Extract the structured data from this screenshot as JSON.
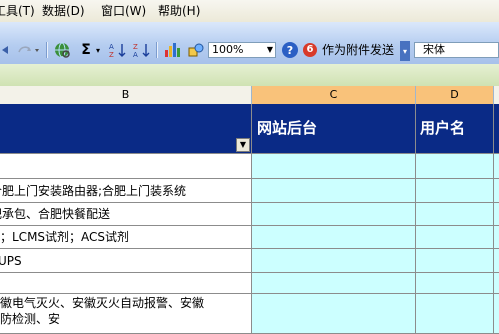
{
  "menu": {
    "tools": "工具(T)",
    "data": "数据(D)",
    "window": "窗口(W)",
    "help": "帮助(H)"
  },
  "toolbar": {
    "zoom": "100%",
    "send_label": "作为附件发送",
    "font_name": "宋体",
    "sigma": "Σ",
    "help_glyph": "?",
    "send_glyph": "6"
  },
  "columns": [
    {
      "label": "B"
    },
    {
      "label": "C"
    },
    {
      "label": "D"
    }
  ],
  "header_row": {
    "col_c": "网站后台",
    "col_d": "用户名"
  },
  "rows": [
    {
      "b": ""
    },
    {
      "b": "合肥上门安装路由器;合肥上门装系统"
    },
    {
      "b": "合肥承包、合肥快餐配送"
    },
    {
      "b": "试剂；LCMS试剂；ACS试剂"
    },
    {
      "b": "UPS"
    },
    {
      "b": ""
    },
    {
      "b": "安徽电气灭火、安徽灭火自动报警、安徽"
    },
    {
      "b": "消防检测、安"
    }
  ],
  "colors": {
    "header_fill": "#0a2a86",
    "row_fill": "#ccffff",
    "selected_col": "#f9c27a"
  }
}
